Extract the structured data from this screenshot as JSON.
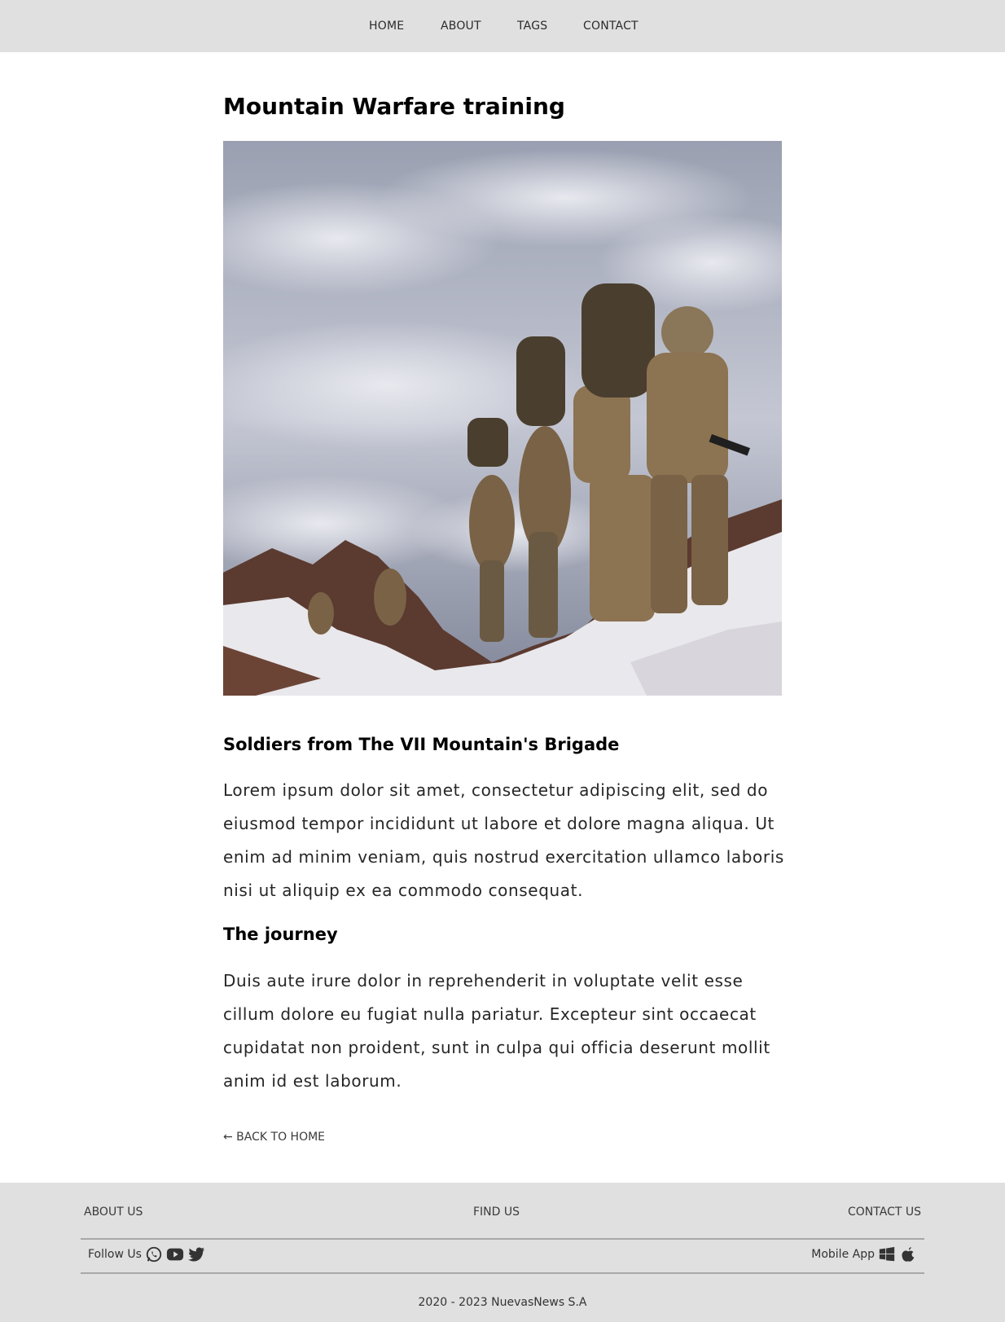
{
  "nav": {
    "items": [
      "HOME",
      "ABOUT",
      "TAGS",
      "CONTACT"
    ]
  },
  "article": {
    "title": "Mountain Warfare training",
    "image_alt": "Soldiers climbing a snowy mountain above the clouds",
    "sections": [
      {
        "heading": "Soldiers from The VII Mountain's Brigade",
        "body": "Lorem ipsum dolor sit amet, consectetur adipiscing elit, sed do eiusmod tempor incididunt ut labore et dolore magna aliqua. Ut enim ad minim veniam, quis nostrud exercitation ullamco laboris nisi ut aliquip ex ea commodo consequat."
      },
      {
        "heading": "The journey",
        "body": "Duis aute irure dolor in reprehenderit in voluptate velit esse cillum dolore eu fugiat nulla pariatur. Excepteur sint occaecat cupidatat non proident, sunt in culpa qui officia deserunt mollit anim id est laborum."
      }
    ],
    "back_link": "← BACK TO HOME"
  },
  "footer": {
    "links": [
      "ABOUT US",
      "FIND US",
      "CONTACT US"
    ],
    "follow_label": "Follow Us",
    "social_icons": [
      "whatsapp-icon",
      "youtube-icon",
      "twitter-icon"
    ],
    "mobile_label": "Mobile App",
    "app_icons": [
      "windows-icon",
      "apple-icon"
    ],
    "copyright": "2020 - 2023 NuevasNews S.A"
  },
  "colors": {
    "header_bg": "#e0e0e0",
    "footer_bg": "#e0e0e0",
    "text": "#000000"
  }
}
